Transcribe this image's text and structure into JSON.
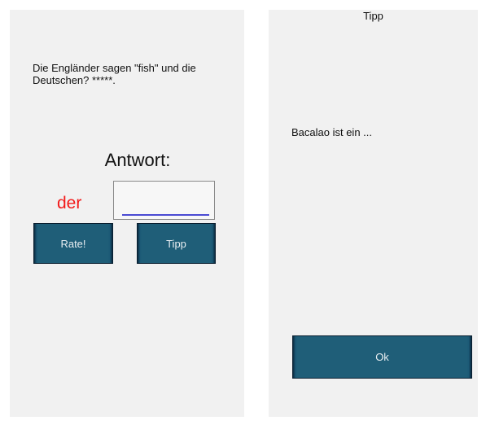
{
  "quiz": {
    "question": "Die Engländer sagen \"fish\" und die Deutschen? *****.",
    "answer_label": "Antwort:",
    "article": "der",
    "answer_value": "",
    "guess_label": "Rate!",
    "hint_label": "Tipp"
  },
  "hint_dialog": {
    "title": "Tipp",
    "text": "Bacalao ist ein ...",
    "ok_label": "Ok"
  },
  "colors": {
    "panel_bg": "#f1f1f1",
    "button_bg": "#1f5e78",
    "article_color": "#f21a1a",
    "input_underline": "#4b4bd2"
  }
}
